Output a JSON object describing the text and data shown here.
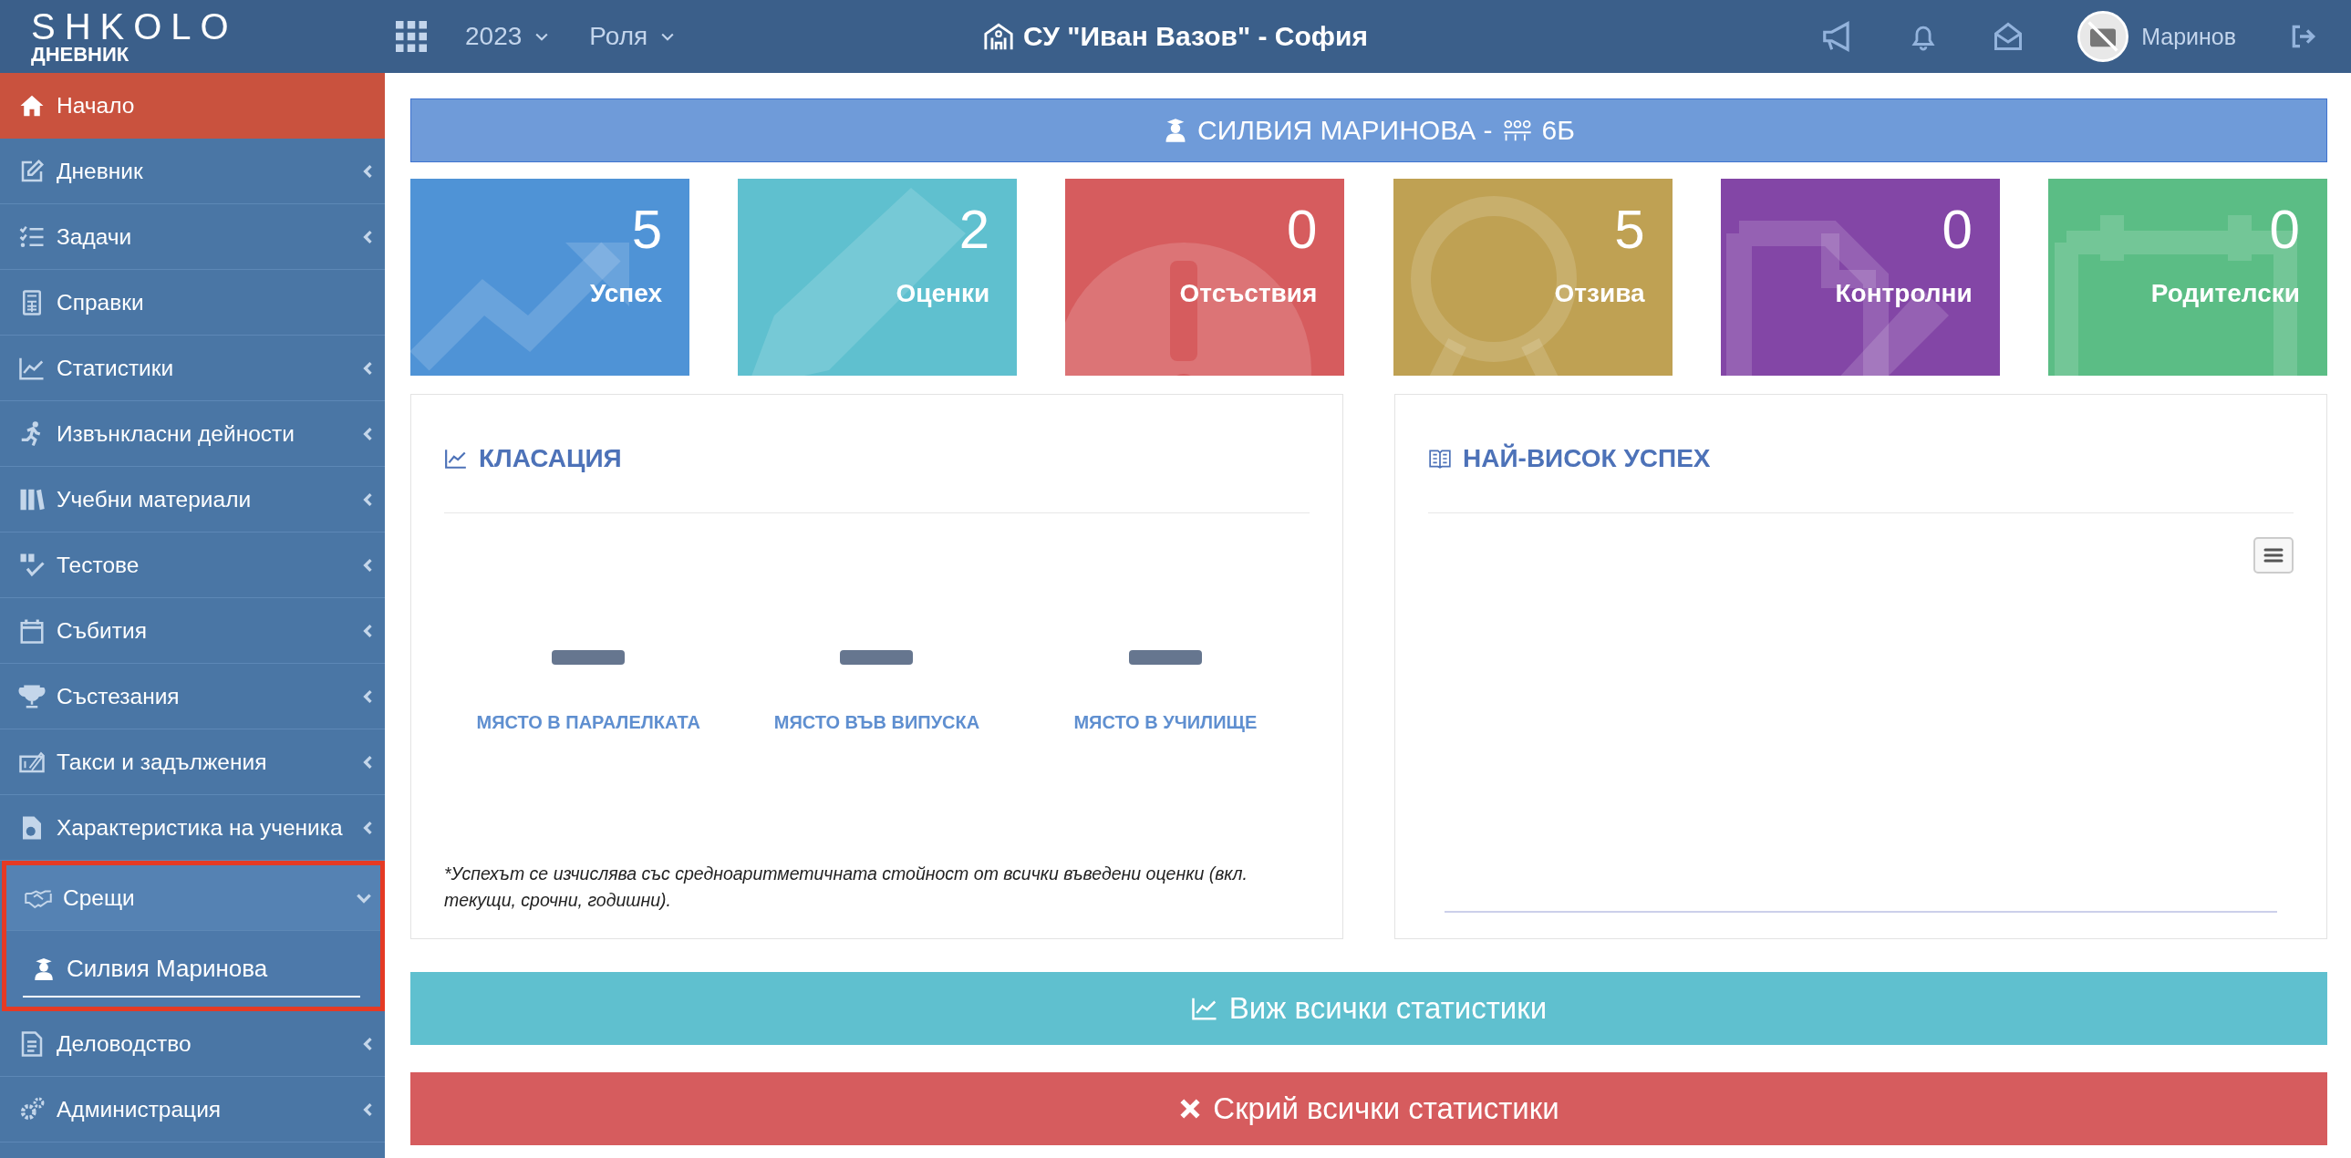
{
  "header": {
    "logo": "SHKOLO",
    "logo_sub": "ДНЕВНИК",
    "year": "2023",
    "role": "Роля",
    "school": "СУ \"Иван Вазов\" - София",
    "user": "Маринов"
  },
  "sidebar": {
    "items": [
      {
        "label": "Начало",
        "kind": "link",
        "selected": true,
        "expanded": false,
        "outlined": false
      },
      {
        "label": "Дневник",
        "kind": "group",
        "selected": false,
        "expanded": false,
        "outlined": false
      },
      {
        "label": "Задачи",
        "kind": "group",
        "selected": false,
        "expanded": false,
        "outlined": false
      },
      {
        "label": "Справки",
        "kind": "link",
        "selected": false,
        "expanded": false,
        "outlined": false
      },
      {
        "label": "Статистики",
        "kind": "group",
        "selected": false,
        "expanded": false,
        "outlined": false
      },
      {
        "label": "Извънкласни дейности",
        "kind": "group",
        "selected": false,
        "expanded": false,
        "outlined": false
      },
      {
        "label": "Учебни материали",
        "kind": "group",
        "selected": false,
        "expanded": false,
        "outlined": false
      },
      {
        "label": "Тестове",
        "kind": "group",
        "selected": false,
        "expanded": false,
        "outlined": false
      },
      {
        "label": "Събития",
        "kind": "group",
        "selected": false,
        "expanded": false,
        "outlined": false
      },
      {
        "label": "Състезания",
        "kind": "group",
        "selected": false,
        "expanded": false,
        "outlined": false
      },
      {
        "label": "Такси и задължения",
        "kind": "group",
        "selected": false,
        "expanded": false,
        "outlined": false
      },
      {
        "label": "Характеристика на ученика",
        "kind": "group",
        "selected": false,
        "expanded": false,
        "outlined": false
      },
      {
        "label": "Срещи",
        "kind": "group",
        "selected": false,
        "expanded": true,
        "outlined": true,
        "children": [
          {
            "label": "Силвия Маринова",
            "selected": true
          }
        ]
      },
      {
        "label": "Деловодство",
        "kind": "group",
        "selected": false,
        "expanded": false,
        "outlined": false
      },
      {
        "label": "Администрация",
        "kind": "group",
        "selected": false,
        "expanded": false,
        "outlined": false
      }
    ]
  },
  "banner": {
    "student": "СИЛВИЯ МАРИНОВА -",
    "class": "6Б"
  },
  "stats": [
    {
      "value": "5",
      "label": "Успех",
      "color": "#4f93d6"
    },
    {
      "value": "2",
      "label": "Оценки",
      "color": "#5fc0cf"
    },
    {
      "value": "0",
      "label": "Отсъствия",
      "color": "#d65c5e"
    },
    {
      "value": "5",
      "label": "Отзива",
      "color": "#bfa153"
    },
    {
      "value": "0",
      "label": "Контролни",
      "color": "#8346a6"
    },
    {
      "value": "0",
      "label": "Родителски",
      "color": "#5bbd85"
    }
  ],
  "ranking": {
    "title": "КЛАСАЦИЯ",
    "places": [
      {
        "label": "МЯСТО В ПАРАЛЕЛКАТА"
      },
      {
        "label": "МЯСТО ВЪВ ВИПУСКА"
      },
      {
        "label": "МЯСТО В УЧИЛИЩЕ"
      }
    ],
    "footnote": "*Успехът се изчислява със средноаритметичната стойност от всички въведени оценки (вкл. текущи, срочни, годишни)."
  },
  "top_success": {
    "title": "НАЙ-ВИСОК УСПЕХ"
  },
  "actions": [
    {
      "label": "Виж всички статистики",
      "kind": "show"
    },
    {
      "label": "Скрий всички статистики",
      "kind": "hide"
    }
  ]
}
